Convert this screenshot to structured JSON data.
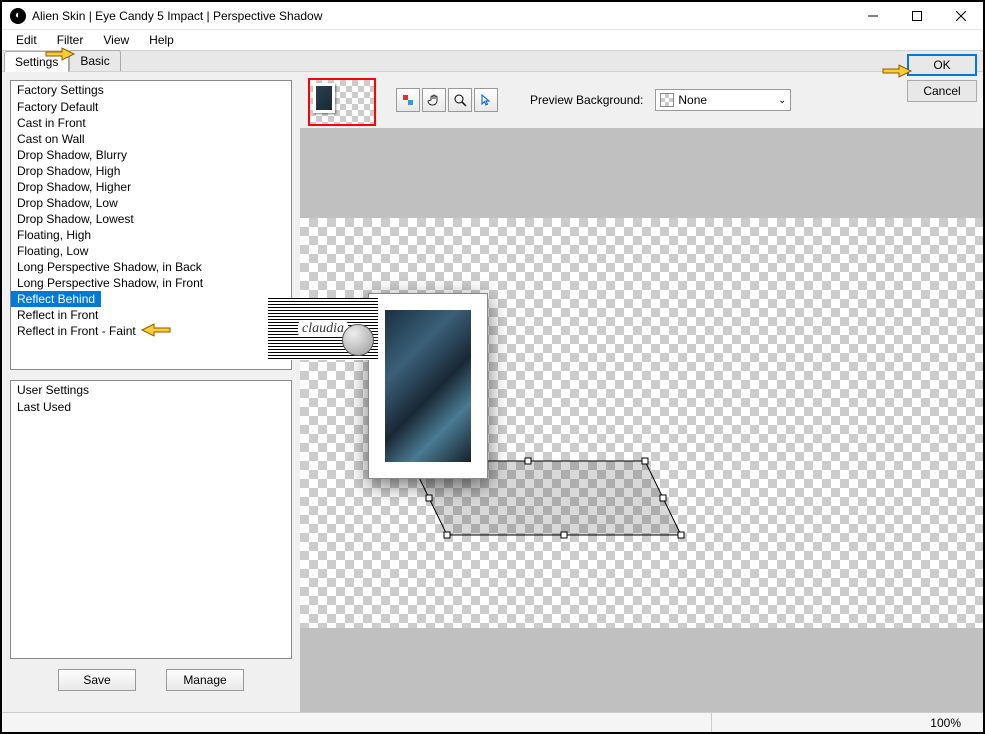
{
  "window": {
    "title": "Alien Skin | Eye Candy 5 Impact | Perspective Shadow"
  },
  "menu": {
    "items": [
      "Edit",
      "Filter",
      "View",
      "Help"
    ]
  },
  "tabs": {
    "items": [
      "Settings",
      "Basic"
    ],
    "active": 0
  },
  "presets": {
    "header": "Factory Settings",
    "items": [
      "Factory Default",
      "Cast in Front",
      "Cast on Wall",
      "Drop Shadow, Blurry",
      "Drop Shadow, High",
      "Drop Shadow, Higher",
      "Drop Shadow, Low",
      "Drop Shadow, Lowest",
      "Floating, High",
      "Floating, Low",
      "Long Perspective Shadow, in Back",
      "Long Perspective Shadow, in Front",
      "Reflect Behind",
      "Reflect in Front",
      "Reflect in Front - Faint"
    ],
    "selected_index": 12
  },
  "user_settings": {
    "header": "User Settings",
    "items": [
      "Last Used"
    ]
  },
  "buttons": {
    "save": "Save",
    "manage": "Manage",
    "ok": "OK",
    "cancel": "Cancel"
  },
  "toolbar": {
    "preview_bg_label": "Preview Background:",
    "preview_bg_value": "None"
  },
  "status": {
    "zoom": "100%"
  },
  "watermark": "claudia"
}
